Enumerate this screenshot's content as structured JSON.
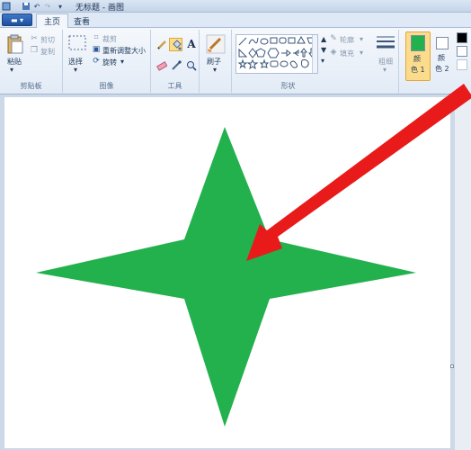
{
  "window": {
    "title": "无标题 - 画图"
  },
  "tabs": [
    {
      "label": "主页"
    },
    {
      "label": "查看"
    }
  ],
  "ribbon": {
    "clipboard": {
      "label": "剪贴板",
      "paste": "粘贴",
      "cut": "剪切",
      "copy": "复制"
    },
    "image": {
      "label": "图像",
      "select": "选择",
      "crop": "裁剪",
      "resize": "重新调整大小",
      "rotate": "旋转"
    },
    "tools": {
      "label": "工具"
    },
    "brushes": {
      "label": "刷子"
    },
    "shapes": {
      "label": "形状",
      "outline": "轮廓",
      "fill": "填充"
    },
    "size": {
      "label": "粗细"
    },
    "color1": {
      "label": "颜色 1",
      "line1": "颜",
      "line2": "色 1",
      "value": "#22b14c"
    },
    "color2": {
      "label": "颜色 2",
      "line1": "颜",
      "line2": "色 2",
      "value": "#ffffff"
    }
  },
  "colors": {
    "star": "#22b14c",
    "arrow": "#e81a1a"
  }
}
